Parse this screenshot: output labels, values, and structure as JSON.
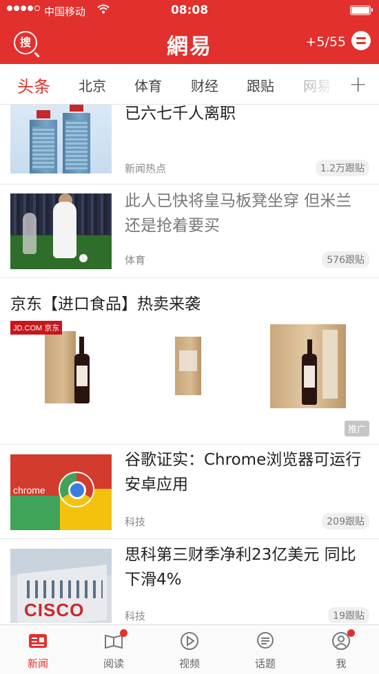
{
  "status_bar": {
    "carrier": "中国移动",
    "time": "08:08"
  },
  "header": {
    "search_label": "搜",
    "logo": "網易",
    "coins": "+5/55"
  },
  "tabs": [
    {
      "label": "头条",
      "active": true
    },
    {
      "label": "北京"
    },
    {
      "label": "体育"
    },
    {
      "label": "财经"
    },
    {
      "label": "跟贴"
    },
    {
      "label": "网易"
    }
  ],
  "add_tab_label": "+",
  "feed": {
    "items": [
      {
        "title": "武钢被曝再“优化”超六千人 此前已六七千人离职",
        "source": "新闻热点",
        "comments": "1.2万跟贴"
      },
      {
        "title": "此人已快将皇马板凳坐穿 但米兰还是抢着要买",
        "source": "体育",
        "comments": "576跟贴"
      },
      {
        "title": "谷歌证实：Chrome浏览器可运行安卓应用",
        "source": "科技",
        "comments": "209跟贴",
        "thumb_text": "chrome"
      },
      {
        "title": "思科第三财季净利23亿美元 同比下滑4%",
        "source": "科技",
        "comments": "19跟贴",
        "thumb_text": "CISCO"
      }
    ],
    "ad": {
      "title": "京东【进口食品】热卖来袭",
      "badge": "JD.COM 京东",
      "tag": "推广"
    }
  },
  "bottom_nav": [
    {
      "label": "新闻",
      "icon": "news-icon",
      "active": true
    },
    {
      "label": "阅读",
      "icon": "book-icon",
      "badge": true
    },
    {
      "label": "视频",
      "icon": "play-icon"
    },
    {
      "label": "话题",
      "icon": "topic-icon"
    },
    {
      "label": "我",
      "icon": "user-icon",
      "badge": true
    }
  ],
  "colors": {
    "accent": "#e1302d"
  }
}
